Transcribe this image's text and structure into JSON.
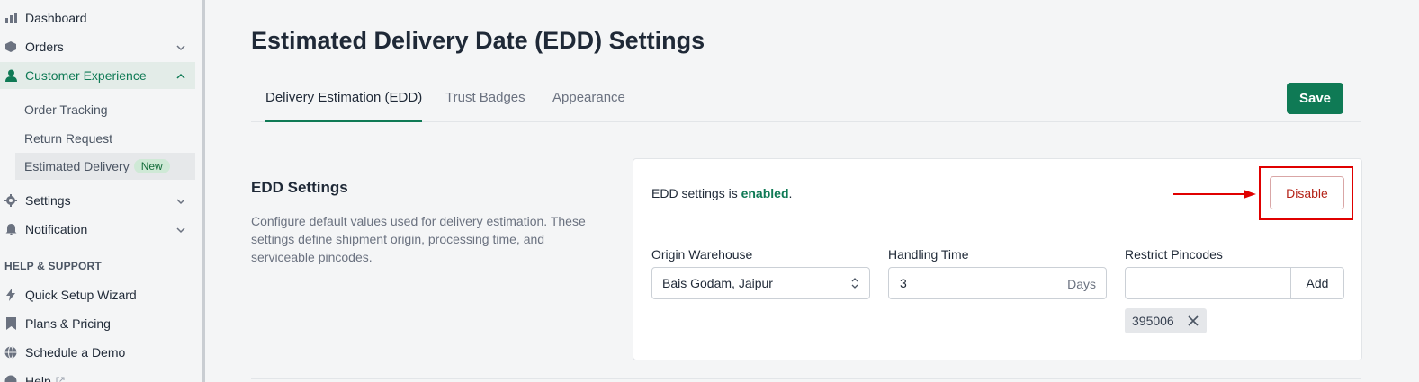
{
  "sidebar": {
    "dashboard": "Dashboard",
    "orders": "Orders",
    "customer_experience": "Customer Experience",
    "sub_items": [
      "Order Tracking",
      "Return Request",
      "Estimated Delivery"
    ],
    "new_badge": "New",
    "settings": "Settings",
    "notification": "Notification",
    "help_heading": "HELP & SUPPORT",
    "quick_setup": "Quick Setup Wizard",
    "plans": "Plans & Pricing",
    "schedule_demo": "Schedule a Demo",
    "help": "Help"
  },
  "page": {
    "title": "Estimated Delivery Date (EDD) Settings",
    "tabs": [
      "Delivery Estimation (EDD)",
      "Trust Badges",
      "Appearance"
    ],
    "save_label": "Save"
  },
  "edd": {
    "title": "EDD Settings",
    "description": "Configure default values used for delivery estimation. These settings define shipment origin, processing time, and serviceable pincodes.",
    "status_prefix": "EDD settings is ",
    "status_value": "enabled",
    "status_suffix": ".",
    "disable_label": "Disable",
    "origin_label": "Origin Warehouse",
    "origin_value": "Bais Godam, Jaipur",
    "handling_label": "Handling Time",
    "handling_value": "3",
    "handling_suffix": "Days",
    "restrict_label": "Restrict Pincodes",
    "pincode_placeholder": "",
    "add_label": "Add",
    "pincodes": [
      "395006"
    ]
  },
  "colors": {
    "accent": "#0f7a55",
    "highlight": "#e00000"
  }
}
